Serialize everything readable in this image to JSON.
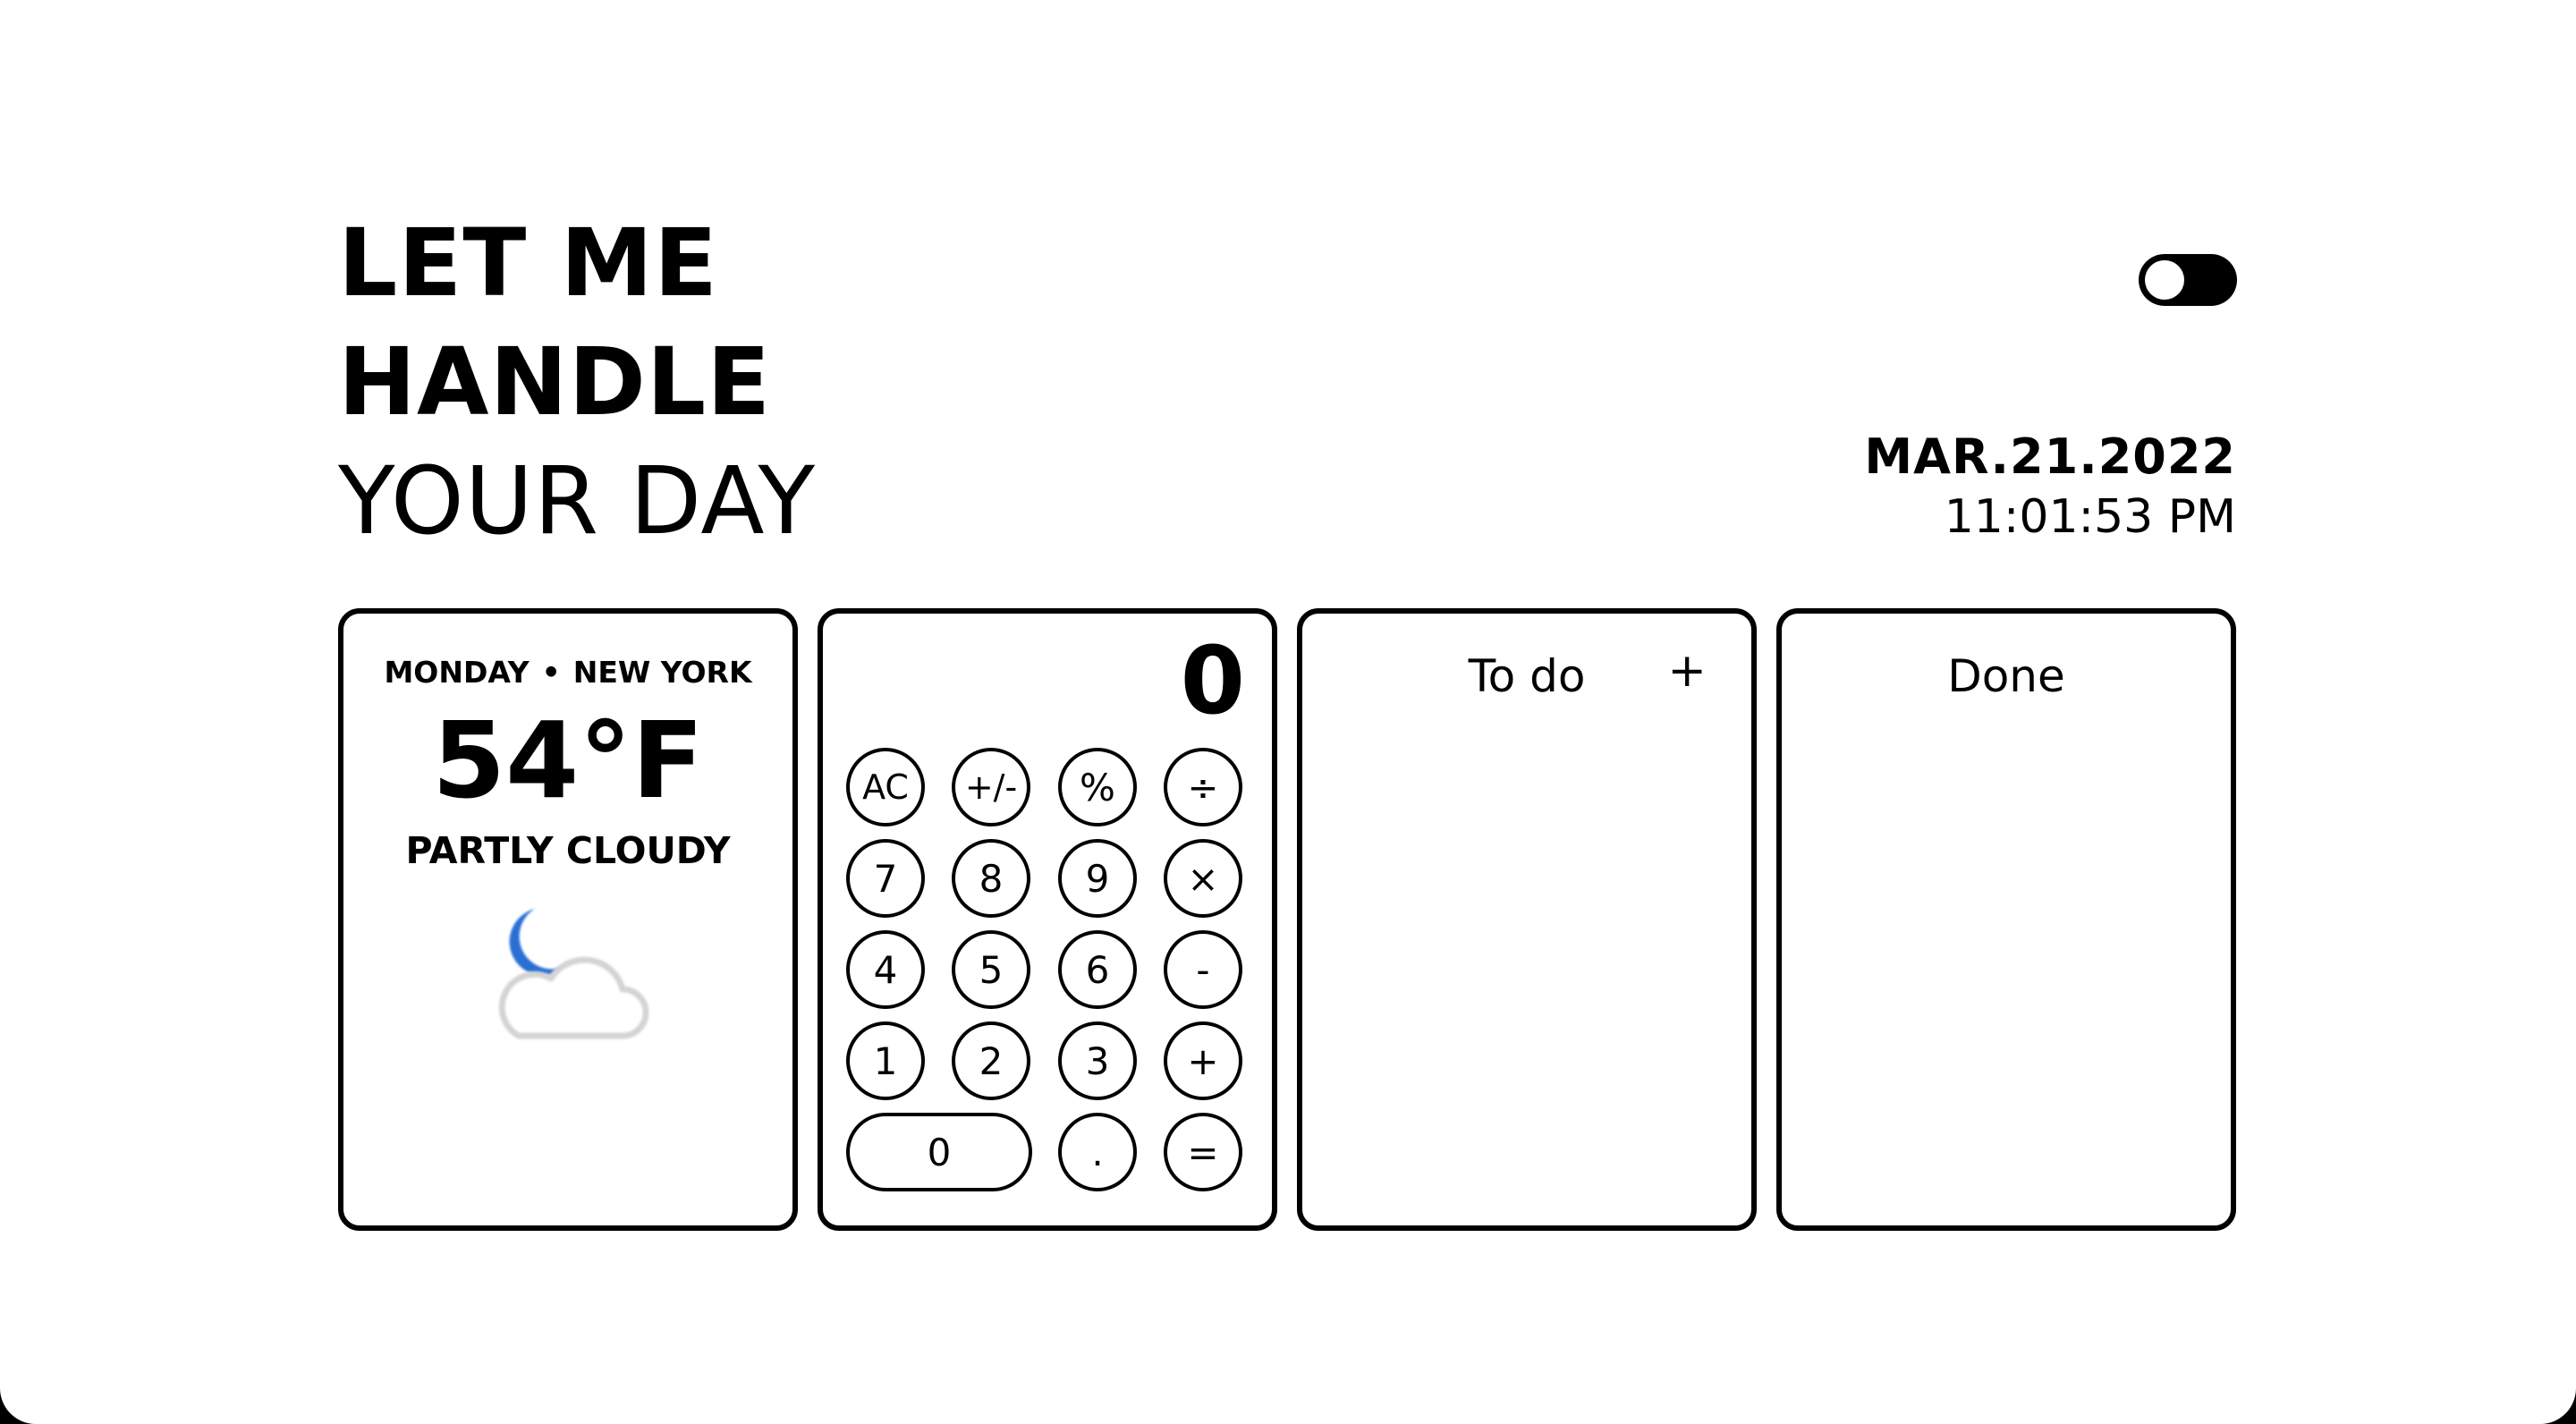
{
  "header": {
    "line1": "LET ME",
    "line2": "HANDLE",
    "line3": "YOUR DAY"
  },
  "theme_toggle": {
    "state": "off"
  },
  "datetime": {
    "date": "MAR.21.2022",
    "time": "11:01:53 PM"
  },
  "weather": {
    "day": "MONDAY",
    "separator": "•",
    "city": "NEW YORK",
    "temperature": "54°F",
    "condition": "PARTLY CLOUDY",
    "icon": "moon-cloud-icon",
    "moon_color": "#2b6fd4",
    "cloud_color": "#d4d4d4"
  },
  "calculator": {
    "display": "0",
    "keys": [
      {
        "label": "AC",
        "name": "calc-key-ac"
      },
      {
        "label": "+/-",
        "name": "calc-key-sign"
      },
      {
        "label": "%",
        "name": "calc-key-percent"
      },
      {
        "label": "÷",
        "name": "calc-key-divide"
      },
      {
        "label": "7",
        "name": "calc-key-7"
      },
      {
        "label": "8",
        "name": "calc-key-8"
      },
      {
        "label": "9",
        "name": "calc-key-9"
      },
      {
        "label": "×",
        "name": "calc-key-multiply"
      },
      {
        "label": "4",
        "name": "calc-key-4"
      },
      {
        "label": "5",
        "name": "calc-key-5"
      },
      {
        "label": "6",
        "name": "calc-key-6"
      },
      {
        "label": "-",
        "name": "calc-key-subtract"
      },
      {
        "label": "1",
        "name": "calc-key-1"
      },
      {
        "label": "2",
        "name": "calc-key-2"
      },
      {
        "label": "3",
        "name": "calc-key-3"
      },
      {
        "label": "+",
        "name": "calc-key-add"
      },
      {
        "label": "0",
        "name": "calc-key-0"
      },
      {
        "label": ".",
        "name": "calc-key-decimal"
      },
      {
        "label": "=",
        "name": "calc-key-equals"
      }
    ]
  },
  "todo": {
    "title": "To do",
    "add_label": "+",
    "items": []
  },
  "done": {
    "title": "Done",
    "items": []
  }
}
